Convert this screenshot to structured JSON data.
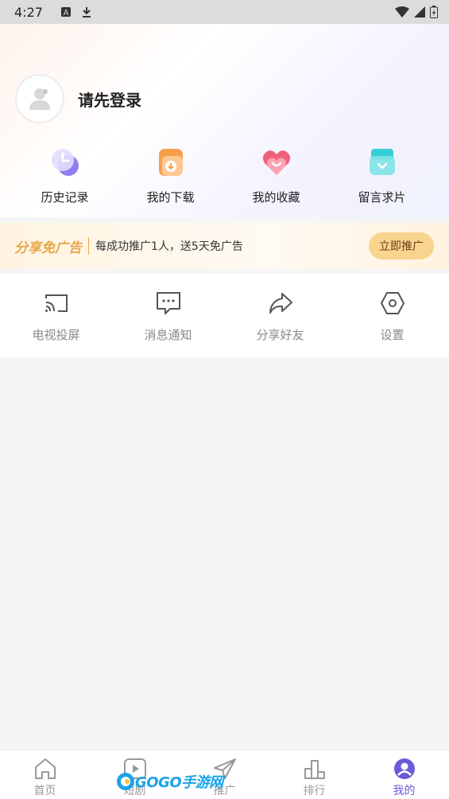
{
  "status_bar": {
    "time": "4:27"
  },
  "profile": {
    "login_prompt": "请先登录"
  },
  "quick_actions": [
    {
      "label": "历史记录",
      "icon": "history-icon",
      "color": "#8f7ff0"
    },
    {
      "label": "我的下载",
      "icon": "download-icon",
      "color": "#f6a04a"
    },
    {
      "label": "我的收藏",
      "icon": "heart-icon",
      "color": "#f0607a"
    },
    {
      "label": "留言求片",
      "icon": "message-box-icon",
      "color": "#35cfd6"
    }
  ],
  "promo": {
    "brand": "分享免广告",
    "text": "每成功推广1人，送5天免广告",
    "button": "立即推广"
  },
  "tools": [
    {
      "label": "电视投屏",
      "icon": "cast-icon"
    },
    {
      "label": "消息通知",
      "icon": "message-icon"
    },
    {
      "label": "分享好友",
      "icon": "share-icon"
    },
    {
      "label": "设置",
      "icon": "settings-icon"
    }
  ],
  "tabs": [
    {
      "label": "首页",
      "icon": "home-icon"
    },
    {
      "label": "短剧",
      "icon": "play-icon"
    },
    {
      "label": "推广",
      "icon": "send-icon"
    },
    {
      "label": "排行",
      "icon": "rank-icon"
    },
    {
      "label": "我的",
      "icon": "user-icon",
      "active": true
    }
  ],
  "watermark": {
    "text": "GOGO手游网"
  },
  "colors": {
    "accent": "#6a5bd8",
    "promo_button": "#f8d48e",
    "promo_brand": "#e8a74a"
  }
}
